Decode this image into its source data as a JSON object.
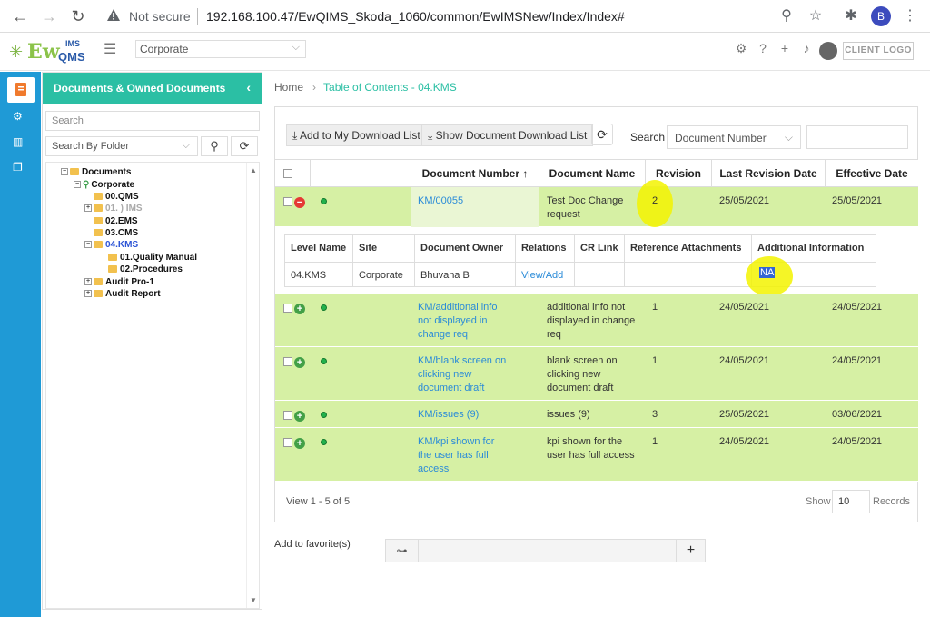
{
  "browser": {
    "not_secure": "Not secure",
    "url": "192.168.100.47/EwQIMS_Skoda_1060/common/EwIMSNew/Index/Index#",
    "profile_initial": "B"
  },
  "app": {
    "logo_ew": "Ew",
    "logo_ims": "IMS",
    "logo_qms": "QMS",
    "site_select": "Corporate",
    "client_logo": "CLIENT LOGO"
  },
  "sidebar": {
    "title": "Documents & Owned Documents",
    "search_placeholder": "Search",
    "search_by": "Search By Folder",
    "tree": [
      {
        "label": "Documents"
      },
      {
        "label": "Corporate"
      },
      {
        "label": "00.QMS"
      },
      {
        "label": "01. ) IMS"
      },
      {
        "label": "02.EMS"
      },
      {
        "label": "03.CMS"
      },
      {
        "label": "04.KMS"
      },
      {
        "label": "01.Quality Manual"
      },
      {
        "label": "02.Procedures"
      },
      {
        "label": "Audit Pro-1"
      },
      {
        "label": "Audit Report"
      }
    ]
  },
  "breadcrumb": {
    "home": "Home",
    "current": "Table of Contents - 04.KMS"
  },
  "toolbar": {
    "add_download": "Add to My Download List",
    "show_download": "Show Document Download List",
    "search_label": "Search",
    "search_field": "Document Number"
  },
  "grid": {
    "headers": {
      "doc_number": "Document Number",
      "doc_name": "Document Name",
      "revision": "Revision",
      "last_rev": "Last Revision Date",
      "effective": "Effective Date"
    },
    "rows": [
      {
        "number": "KM/00055",
        "name": "Test Doc Change request",
        "revision": "2",
        "last_rev": "25/05/2021",
        "effective": "25/05/2021"
      },
      {
        "number": "KM/additional info not displayed in change req",
        "name": "additional info not displayed in change req",
        "revision": "1",
        "last_rev": "24/05/2021",
        "effective": "24/05/2021"
      },
      {
        "number": "KM/blank screen on clicking new document draft",
        "name": "blank screen on clicking new document draft",
        "revision": "1",
        "last_rev": "24/05/2021",
        "effective": "24/05/2021"
      },
      {
        "number": "KM/issues (9)",
        "name": "issues (9)",
        "revision": "3",
        "last_rev": "25/05/2021",
        "effective": "03/06/2021"
      },
      {
        "number": "KM/kpi shown for the user has full access",
        "name": "kpi shown for the user has full access",
        "revision": "1",
        "last_rev": "24/05/2021",
        "effective": "24/05/2021"
      }
    ],
    "detail": {
      "headers": [
        "Level Name",
        "Site",
        "Document Owner",
        "Relations",
        "CR Link",
        "Reference Attachments",
        "Additional Information"
      ],
      "values": [
        "04.KMS",
        "Corporate",
        "Bhuvana  B",
        "View/Add",
        "",
        "",
        "NA"
      ]
    }
  },
  "footer": {
    "pager": "View 1 - 5 of 5",
    "show": "Show",
    "show_value": "10",
    "records": "Records"
  },
  "favorites": {
    "label": "Add to favorite(s)"
  },
  "colors": {
    "accent": "#2bbfa4",
    "rail": "#1f9ad6",
    "row": "#d6f0a4",
    "link": "#2a8bd8"
  }
}
